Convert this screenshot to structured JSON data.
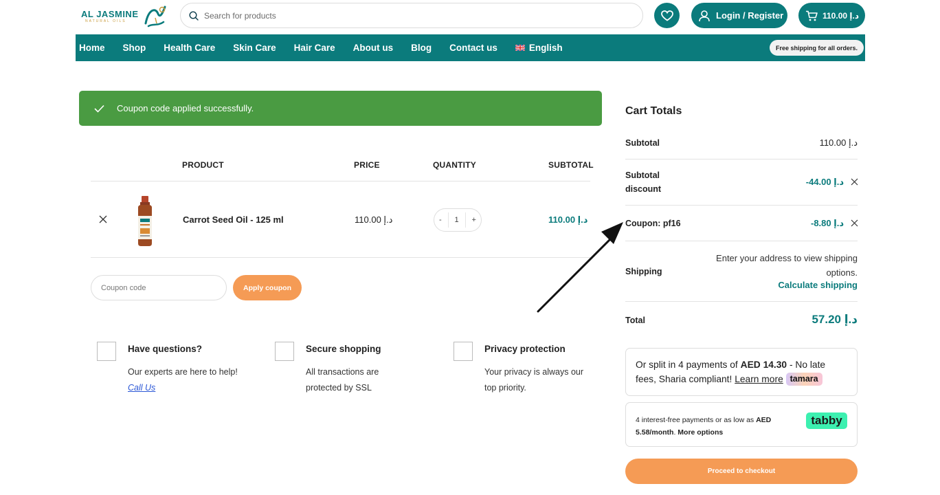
{
  "header": {
    "logo_text": "AL JASMINE",
    "logo_sub": "NATURAL OILS",
    "search_placeholder": "Search for products",
    "login_label": "Login / Register",
    "cart_total": "110.00 د.إ"
  },
  "nav": {
    "items": [
      "Home",
      "Shop",
      "Health Care",
      "Skin Care",
      "Hair Care",
      "About us",
      "Blog",
      "Contact us"
    ],
    "language": "English",
    "free_shipping": "Free shipping for all orders."
  },
  "notice": {
    "message": "Coupon code applied successfully."
  },
  "cart_table": {
    "headers": {
      "product": "PRODUCT",
      "price": "PRICE",
      "quantity": "QUANTITY",
      "subtotal": "SUBTOTAL"
    },
    "item": {
      "name": "Carrot Seed Oil - 125 ml",
      "price": "110.00 د.إ",
      "qty_minus": "-",
      "quantity": "1",
      "qty_plus": "+",
      "subtotal": "110.00 د.إ"
    }
  },
  "coupon": {
    "placeholder": "Coupon code",
    "apply_label": "Apply coupon"
  },
  "features": [
    {
      "title": "Have questions?",
      "desc": "Our experts are here to help!",
      "link": "Call Us"
    },
    {
      "title": "Secure shopping",
      "desc": "All transactions are protected by SSL"
    },
    {
      "title": "Privacy protection",
      "desc": "Your privacy is always our top priority."
    }
  ],
  "cart_totals": {
    "title": "Cart Totals",
    "subtotal_label": "Subtotal",
    "subtotal_value": "110.00 د.إ",
    "discount_label": "Subtotal discount",
    "discount_value": "-44.00 د.إ",
    "coupon_label": "Coupon: pf16",
    "coupon_value": "-8.80 د.إ",
    "shipping_label": "Shipping",
    "shipping_info": "Enter your address to view shipping options.",
    "calculate_shipping": "Calculate shipping",
    "total_label": "Total",
    "total_value": "57.20 د.إ"
  },
  "tamara": {
    "text_before": "Or split in 4 payments of ",
    "amount": "AED 14.30",
    "text_after": " - No late fees, Sharia compliant! ",
    "learn_more": "Learn more",
    "badge": "tamara"
  },
  "tabby": {
    "text_before": "4 interest-free payments or as low as ",
    "amount": "AED 5.58/month",
    "text_mid": ". ",
    "more_options": "More options",
    "badge": "tabby"
  },
  "checkout_label": "Proceed to checkout",
  "colors": {
    "brand": "#0b7b7c",
    "accent": "#f59b55",
    "success": "#4a9b42"
  }
}
